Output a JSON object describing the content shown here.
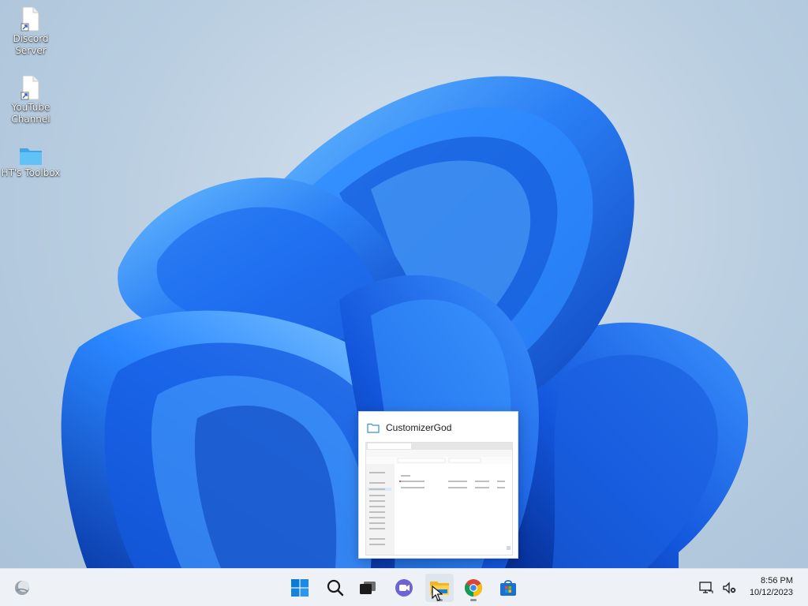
{
  "desktop": {
    "icons": [
      {
        "label": "Discord\nServer",
        "icon": "shortcut-file-icon"
      },
      {
        "label": "YouTube\nChannel",
        "icon": "shortcut-file-icon"
      },
      {
        "label": "HT's Toolbox",
        "icon": "folder-icon"
      }
    ]
  },
  "preview": {
    "title": "CustomizerGod",
    "icon": "folder-outline-icon"
  },
  "taskbar": {
    "apps": [
      {
        "name": "Start",
        "icon": "windows-start-icon"
      },
      {
        "name": "Search",
        "icon": "search-icon"
      },
      {
        "name": "Task View",
        "icon": "task-view-icon"
      },
      {
        "name": "Chat",
        "icon": "teams-chat-icon"
      },
      {
        "name": "File Explorer",
        "icon": "file-explorer-icon"
      },
      {
        "name": "Google Chrome",
        "icon": "chrome-icon"
      },
      {
        "name": "Microsoft Store",
        "icon": "store-icon"
      }
    ],
    "widgets_icon": "widgets-weather-icon",
    "tray": {
      "network_icon": "network-icon",
      "volume_icon": "volume-muted-icon",
      "time": "8:56 PM",
      "date": "10/12/2023"
    }
  },
  "colors": {
    "bloom_light": "#4aa3ff",
    "bloom_mid": "#1f6ff0",
    "bloom_dark": "#0b3fb8",
    "taskbar": "#eef1f5"
  }
}
